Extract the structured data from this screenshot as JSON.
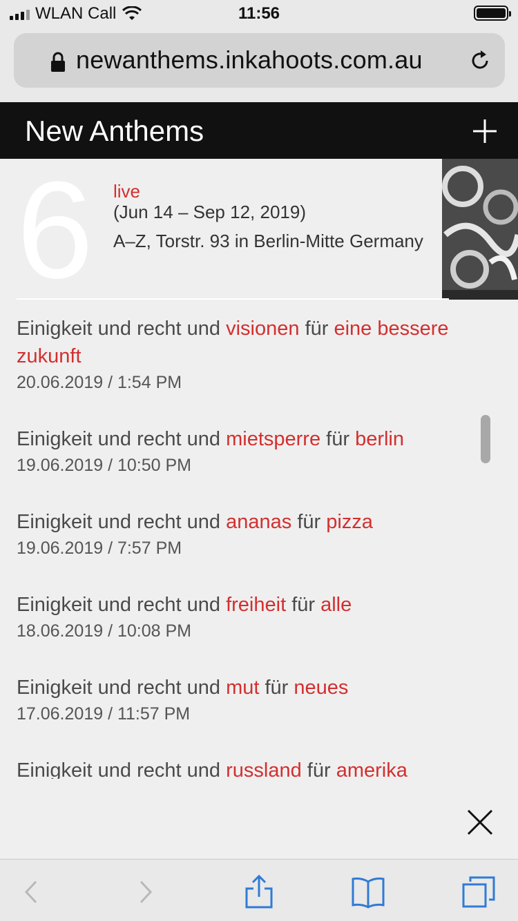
{
  "status_bar": {
    "carrier": "WLAN Call",
    "time": "11:56"
  },
  "browser": {
    "url": "newanthems.inkahoots.com.au"
  },
  "site": {
    "title": "New Anthems"
  },
  "event": {
    "number": "6",
    "status": "live",
    "dates": "(Jun 14 – Sep 12, 2019)",
    "venue": "A–Z, Torstr. 93 in Berlin-Mitte Germany"
  },
  "anthems": [
    {
      "prefix": "Einigkeit und recht und",
      "word1": "visionen",
      "mid": "für",
      "word2": "eine bessere zukunft",
      "date": "20.06.2019 / 1:54 PM"
    },
    {
      "prefix": "Einigkeit und recht und",
      "word1": "mietsperre",
      "mid": "für",
      "word2": "berlin",
      "date": "19.06.2019 / 10:50 PM"
    },
    {
      "prefix": "Einigkeit und recht und",
      "word1": "ananas",
      "mid": "für",
      "word2": "pizza",
      "date": "19.06.2019 / 7:57 PM"
    },
    {
      "prefix": "Einigkeit und recht und",
      "word1": "freiheit",
      "mid": "für",
      "word2": "alle",
      "date": "18.06.2019 / 10:08 PM"
    },
    {
      "prefix": "Einigkeit und recht und",
      "word1": "mut",
      "mid": "für",
      "word2": "neues",
      "date": "17.06.2019 / 11:57 PM"
    },
    {
      "prefix": "Einigkeit und recht und",
      "word1": "russland",
      "mid": "für",
      "word2": "amerika",
      "date": ""
    }
  ],
  "colors": {
    "accent": "#d32f2f",
    "header_bg": "#111111",
    "page_bg": "#efefef"
  },
  "icons": {
    "lock": "lock-icon",
    "reload": "reload-icon",
    "plus": "plus-icon",
    "close": "close-icon",
    "back": "chevron-left-icon",
    "forward": "chevron-right-icon",
    "share": "share-icon",
    "bookmarks": "bookmarks-icon",
    "tabs": "tabs-icon"
  }
}
